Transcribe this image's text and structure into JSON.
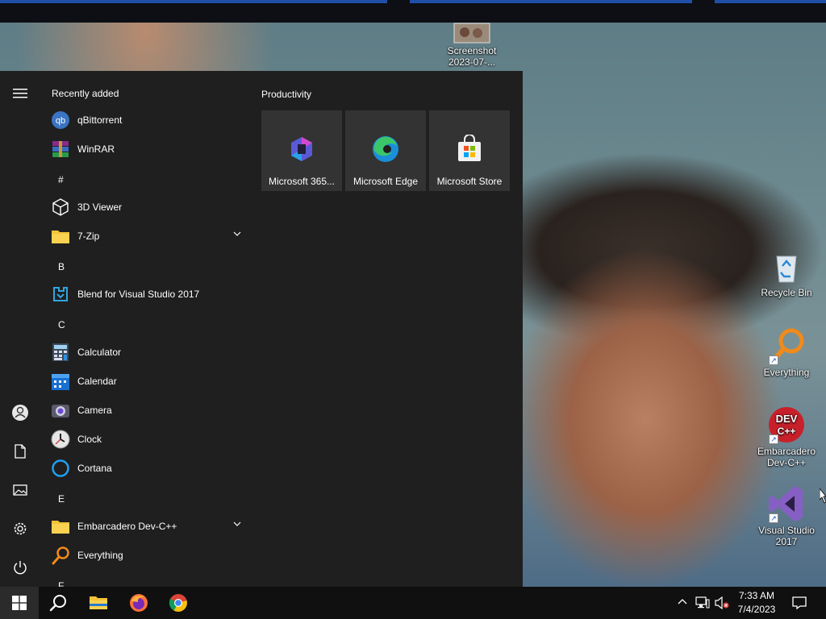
{
  "desktop": {
    "icons": [
      {
        "name": "screenshot-file",
        "label": "Screenshot 2023-07-..."
      },
      {
        "name": "recycle-bin",
        "label": "Recycle Bin"
      },
      {
        "name": "everything",
        "label": "Everything"
      },
      {
        "name": "embarcadero-devcpp",
        "label": "Embarcadero Dev-C++"
      },
      {
        "name": "visual-studio-2017",
        "label": "Visual Studio 2017"
      }
    ]
  },
  "start_menu": {
    "recently_added_label": "Recently added",
    "recent_apps": [
      {
        "label": "qBittorrent",
        "icon": "qbittorrent-icon"
      },
      {
        "label": "WinRAR",
        "icon": "winrar-icon"
      }
    ],
    "groups": [
      {
        "letter": "#",
        "apps": [
          {
            "label": "3D Viewer",
            "icon": "3d-cube-icon"
          },
          {
            "label": "7-Zip",
            "icon": "folder-icon",
            "expandable": true
          }
        ]
      },
      {
        "letter": "B",
        "apps": [
          {
            "label": "Blend for Visual Studio 2017",
            "icon": "blend-icon"
          }
        ]
      },
      {
        "letter": "C",
        "apps": [
          {
            "label": "Calculator",
            "icon": "calculator-icon"
          },
          {
            "label": "Calendar",
            "icon": "calendar-icon"
          },
          {
            "label": "Camera",
            "icon": "camera-icon"
          },
          {
            "label": "Clock",
            "icon": "clock-icon"
          },
          {
            "label": "Cortana",
            "icon": "cortana-icon"
          }
        ]
      },
      {
        "letter": "E",
        "apps": [
          {
            "label": "Embarcadero Dev-C++",
            "icon": "folder-icon",
            "expandable": true
          },
          {
            "label": "Everything",
            "icon": "everything-icon"
          }
        ]
      },
      {
        "letter": "F",
        "apps": []
      }
    ],
    "tile_group": {
      "title": "Productivity",
      "tiles": [
        {
          "label": "Microsoft 365...",
          "icon": "microsoft-365-icon"
        },
        {
          "label": "Microsoft Edge",
          "icon": "edge-icon"
        },
        {
          "label": "Microsoft Store",
          "icon": "store-icon"
        }
      ]
    },
    "rail": [
      "hamburger-menu-icon",
      "user-icon",
      "documents-icon",
      "pictures-icon",
      "settings-icon",
      "power-icon"
    ]
  },
  "taskbar": {
    "pinned": [
      "start-button",
      "search",
      "file-explorer",
      "firefox",
      "chrome"
    ],
    "clock_time": "7:33 AM",
    "clock_date": "7/4/2023",
    "tray": [
      "chevron-up-icon",
      "network-icon",
      "volume-muted-icon",
      "action-center-icon"
    ]
  },
  "colors": {
    "start_bg": "#1f1f1f",
    "tile_bg": "#333333",
    "taskbar_bg": "#101010",
    "accent": "#0078d4"
  }
}
